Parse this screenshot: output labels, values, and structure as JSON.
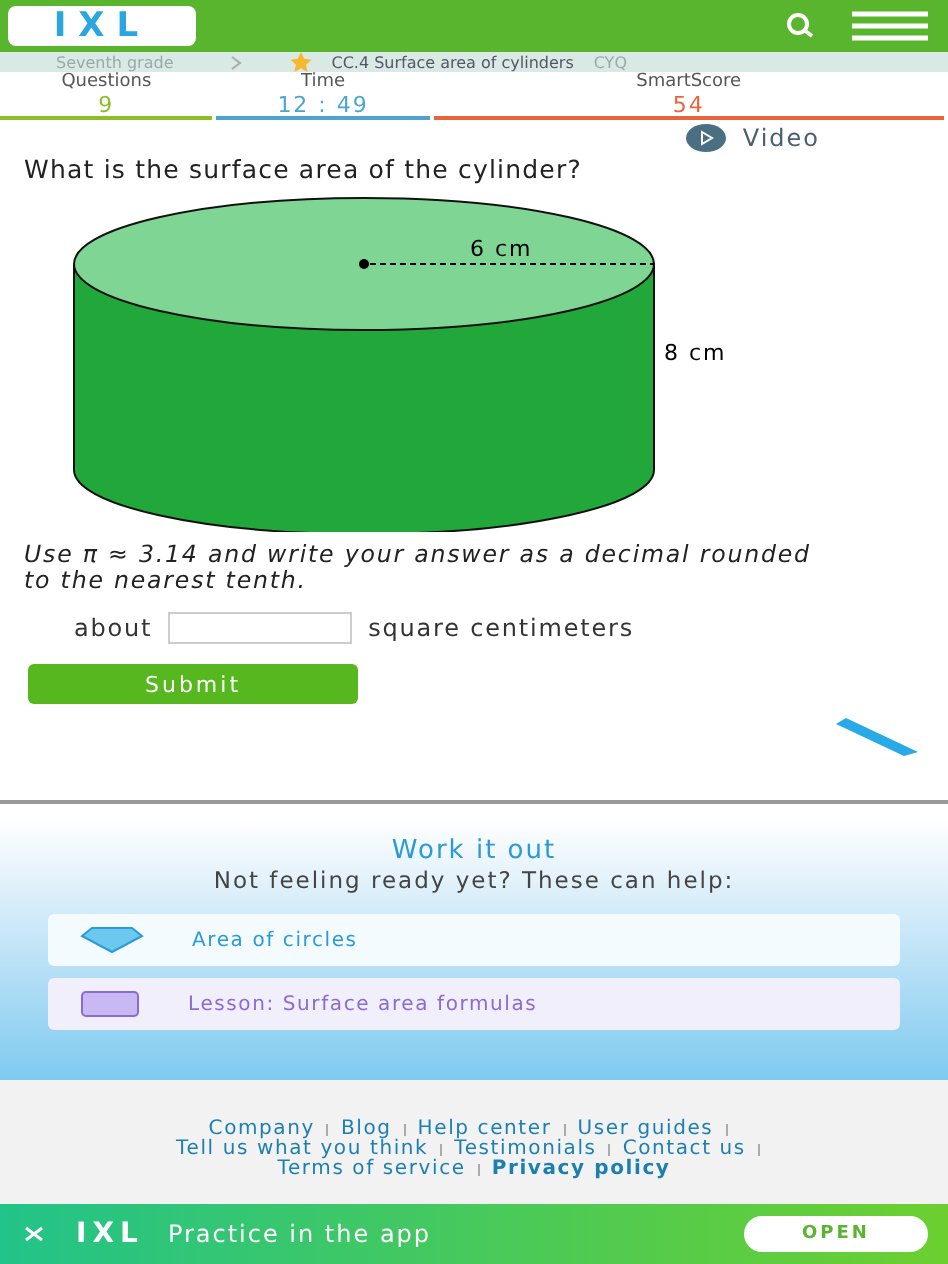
{
  "header": {
    "logo": "IXL"
  },
  "breadcrumb": {
    "grade": "Seventh grade",
    "skill": "CC.4 Surface area of cylinders",
    "code": "CYQ"
  },
  "stats": [
    {
      "label": "Questions",
      "value": "9",
      "color": "#8cbf26"
    },
    {
      "label": "Time",
      "value": "12 : 49",
      "color": "#4da5cf"
    },
    {
      "label": "SmartScore",
      "value": "54",
      "color": "#e8643c"
    }
  ],
  "video": {
    "label": "Video"
  },
  "question": {
    "prompt": "What is the surface area of the cylinder?",
    "radius_label": "6 cm",
    "height_label": "8 cm",
    "instruction": "Use π ≈ 3.14 and write your answer as a decimal rounded to the nearest tenth.",
    "prefix": "about",
    "suffix": "square centimeters",
    "submit": "Submit"
  },
  "work_it_out": {
    "title": "Work it out",
    "subtitle": "Not feeling ready yet? These can help:",
    "items": [
      {
        "kind": "skill",
        "label": "Area of circles"
      },
      {
        "kind": "lesson",
        "label": "Lesson: Surface area formulas"
      }
    ]
  },
  "footer": {
    "links": [
      {
        "label": "Company",
        "bold": false
      },
      {
        "label": "Blog",
        "bold": false
      },
      {
        "label": "Help center",
        "bold": false
      },
      {
        "label": "User guides",
        "bold": false
      },
      {
        "label": "Tell us what you think",
        "bold": false
      },
      {
        "label": "Testimonials",
        "bold": false
      },
      {
        "label": "Contact us",
        "bold": false
      },
      {
        "label": "Terms of service",
        "bold": false
      },
      {
        "label": "Privacy policy",
        "bold": true
      }
    ]
  },
  "app_banner": {
    "logo": "IXL",
    "text": "Practice in the app",
    "button": "OPEN"
  }
}
